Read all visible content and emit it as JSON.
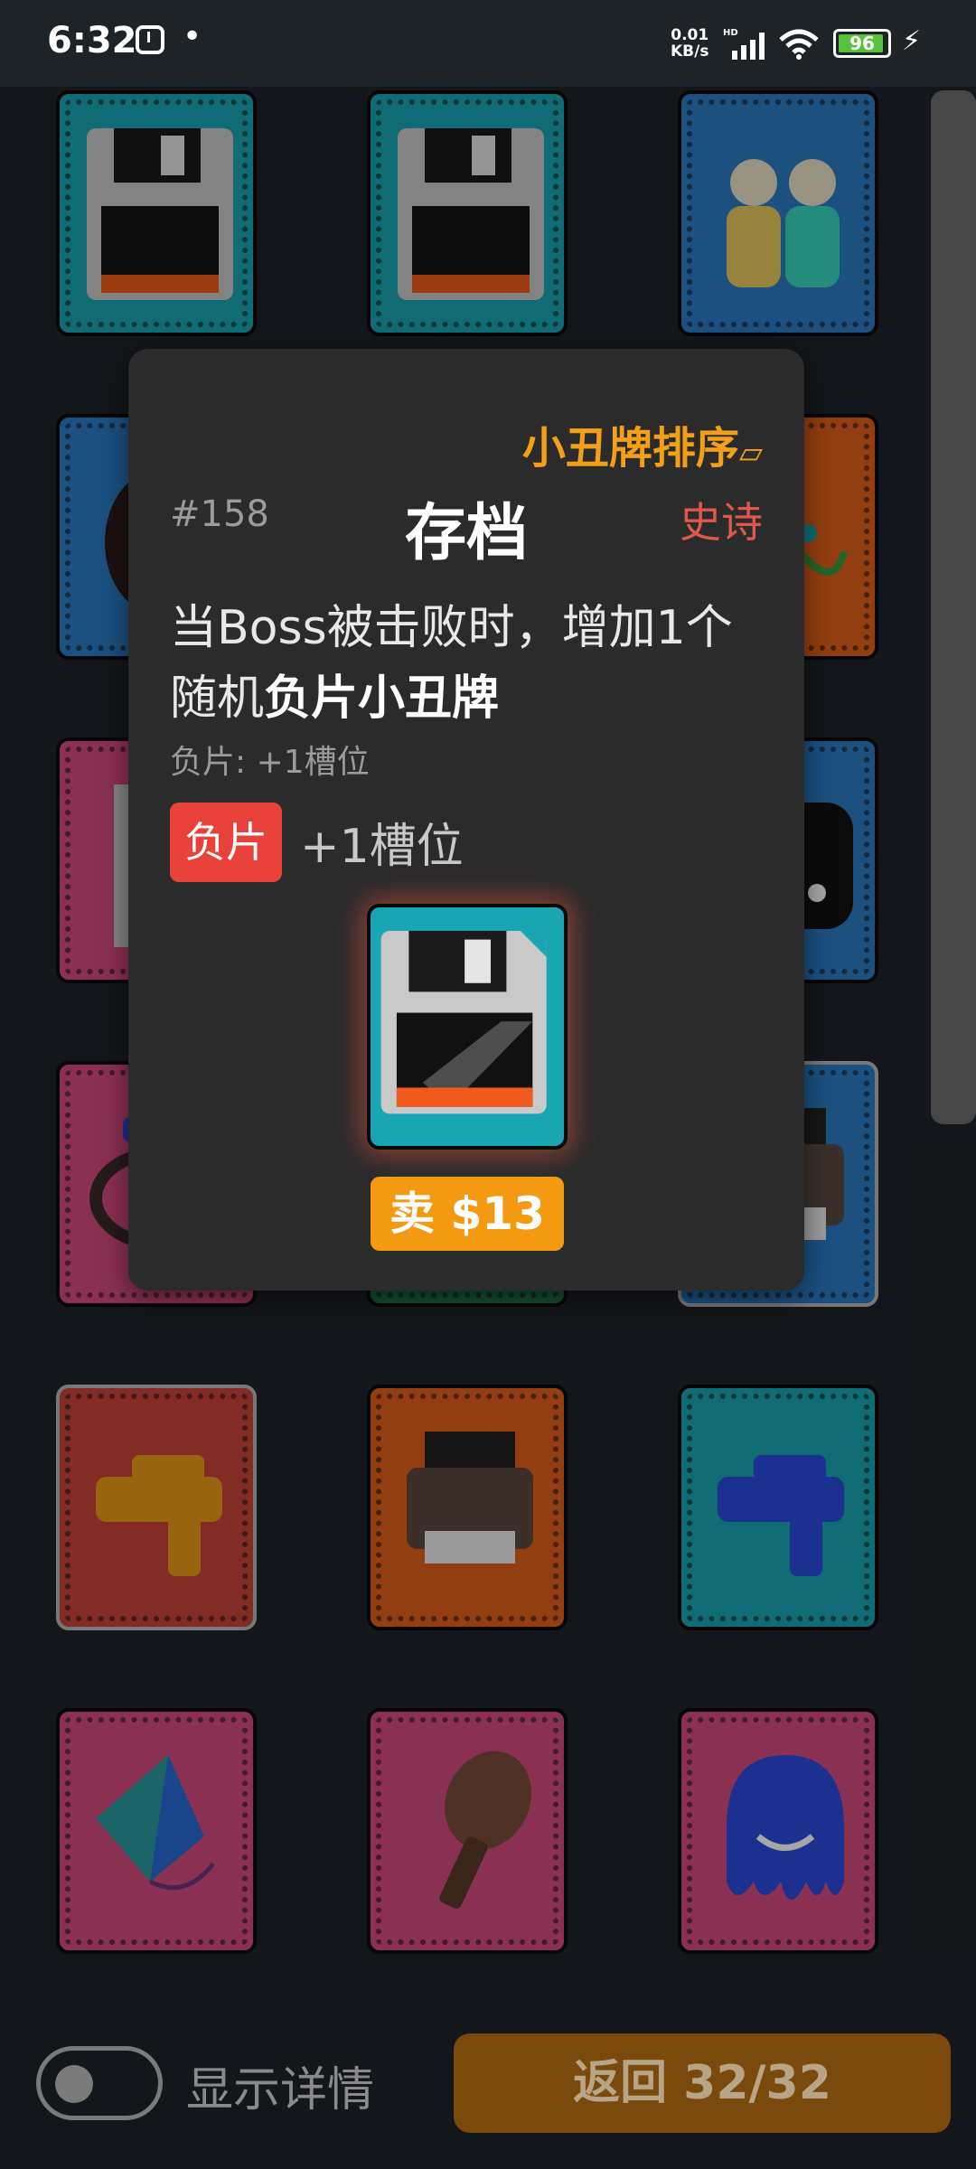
{
  "status_bar": {
    "time": "6:32",
    "net_speed_value": "0.01",
    "net_speed_unit": "KB/s",
    "network_type": "HD",
    "battery": "96"
  },
  "colors": {
    "background": "#1e2328",
    "accent_orange": "#f3a018",
    "rarity_red": "#e0584b",
    "negative_tag": "#e8423b",
    "sell_button": "#f49a12",
    "return_button": "#7a4a0c"
  },
  "cards": [
    {
      "bg": "#1aa5b3",
      "icon": "floppy-disk-icon"
    },
    {
      "bg": "#1aa5b3",
      "icon": "floppy-disk-icon"
    },
    {
      "bg": "#2a7bc4",
      "icon": "hina-dolls-icon"
    },
    {
      "bg": "#2a7bc4",
      "icon": "dark-figure-icon"
    },
    {
      "bg": "#3b3b3b",
      "icon": "unknown-card-icon"
    },
    {
      "bg": "#e0601a",
      "icon": "confetti-icon"
    },
    {
      "bg": "#d44a7e",
      "icon": "stick-icon"
    },
    {
      "bg": "#3b3b3b",
      "icon": "unknown-card-icon"
    },
    {
      "bg": "#2a7bc4",
      "icon": "dice-icon"
    },
    {
      "bg": "#d44a7e",
      "icon": "ring-icon"
    },
    {
      "bg": "#1f7a4a",
      "icon": "unknown-card-icon"
    },
    {
      "bg": "#2a7bc4",
      "icon": "printer-icon"
    },
    {
      "bg": "#c9443a",
      "icon": "water-gun-icon"
    },
    {
      "bg": "#e0601a",
      "icon": "printer-icon"
    },
    {
      "bg": "#1aa5b3",
      "icon": "water-gun-icon"
    },
    {
      "bg": "#d44a7e",
      "icon": "kite-icon"
    },
    {
      "bg": "#d44a7e",
      "icon": "microphone-icon"
    },
    {
      "bg": "#d44a7e",
      "icon": "blob-smiley-icon"
    }
  ],
  "popup": {
    "sort_label": "小丑牌排序",
    "id": "#158",
    "title": "存档",
    "rarity": "史诗",
    "desc_plain": "当Boss被击败时，增加1个随机",
    "desc_bold": "负片小丑牌",
    "sub_note": "负片: +1槽位",
    "tag_label": "负片",
    "tag_text": "+1槽位",
    "sell_label": "卖 $13"
  },
  "bottom": {
    "toggle_label": "显示详情",
    "return_label": "返回 32/32"
  }
}
